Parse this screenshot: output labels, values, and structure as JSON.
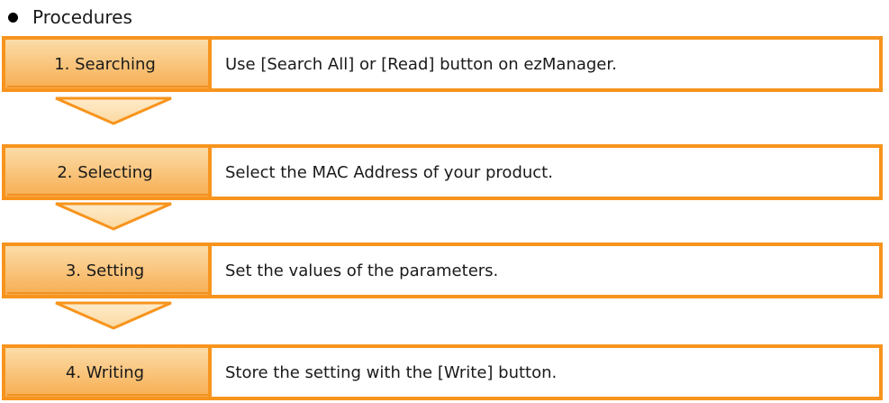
{
  "heading": "Procedures",
  "colors": {
    "accent": "#F7941D",
    "accent_light": "#F9A94B",
    "label_fill_top": "#F9D49A",
    "label_fill_bottom": "#F6A94A",
    "arrow_fill": "#FCE2B8"
  },
  "steps": [
    {
      "label": "1. Searching",
      "description": "Use [Search All] or [Read] button on ezManager."
    },
    {
      "label": "2. Selecting",
      "description": "Select the MAC Address of your product."
    },
    {
      "label": "3. Setting",
      "description": "Set the values of the parameters."
    },
    {
      "label": "4. Writing",
      "description": "Store the setting with the [Write] button."
    }
  ]
}
